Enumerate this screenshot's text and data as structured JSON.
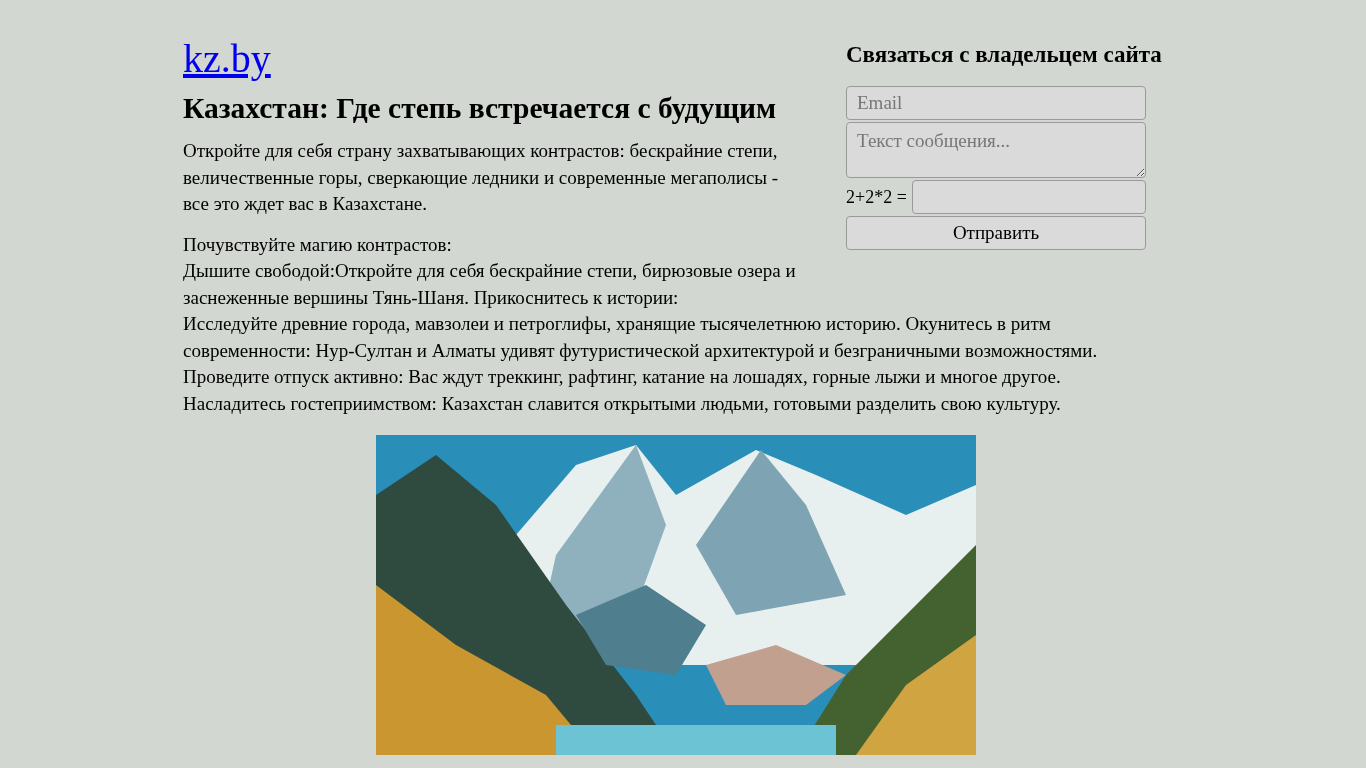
{
  "site_link": "kz.by",
  "heading": "Казахстан: Где степь встречается с будущим",
  "intro": "Откройте для себя страну захватывающих контрастов: бескрайние степи, величественные горы, сверкающие ледники и современные мегаполисы - все это ждет вас в Казахстане.",
  "details": [
    "Почувствуйте магию контрастов:",
    "Дышите свободой:Откройте для себя бескрайние степи, бирюзовые озера и заснеженные вершины Тянь-Шаня. Прикоснитесь к истории:",
    "Исследуйте древние города, мавзолеи и петроглифы, хранящие тысячелетнюю историю. Окунитесь в ритм современности: Нур-Султан и Алматы удивят футуристической архитектурой и безграничными возможностями.",
    "Проведите отпуск активно: Вас ждут треккинг, рафтинг, катание на лошадях, горные лыжи и многое другое.",
    "Насладитесь гостеприимством: Казахстан славится открытыми людьми, готовыми разделить свою культуру."
  ],
  "contact_form": {
    "title": "Связаться с владельцем сайта",
    "email": {
      "placeholder": "Email"
    },
    "message": {
      "placeholder": "Текст сообщения..."
    },
    "captcha_label": "2+2*2 =",
    "submit": "Отправить"
  }
}
